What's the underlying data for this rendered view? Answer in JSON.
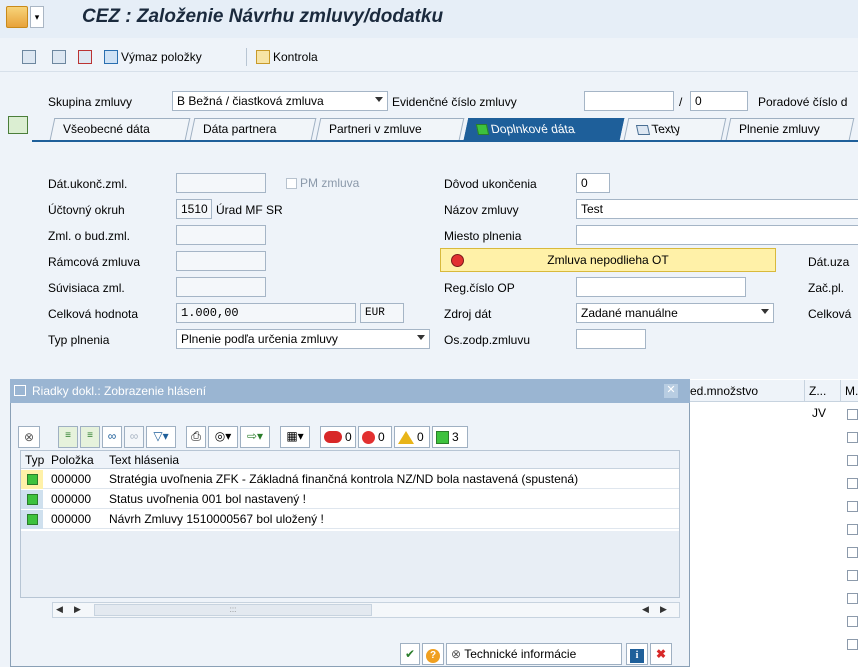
{
  "window": {
    "title": "CEZ : Založenie Návrhu zmluvy/dodatku"
  },
  "toolbar": {
    "delete_item": "Výmaz položky",
    "check": "Kontrola"
  },
  "header": {
    "group_label": "Skupina zmluvy",
    "group_value": "B Bežná / čiastková zmluva",
    "evidence_label": "Evidenčné číslo zmluvy",
    "evidence_slash": "/",
    "evidence_part2": "0",
    "order_label": "Poradové číslo d"
  },
  "tabs": [
    {
      "label": "Všeobecné dáta"
    },
    {
      "label": "Dáta partnera"
    },
    {
      "label": "Partneri v zmluve"
    },
    {
      "label": "Doplnkové dáta"
    },
    {
      "label": "Texty"
    },
    {
      "label": "Plnenie zmluvy"
    }
  ],
  "form": {
    "end_date_label": "Dát.ukonč.zml.",
    "pm_label": "PM zmluva",
    "reason_label": "Dôvod ukončenia",
    "reason_value": "0",
    "account_label": "Účtovný okruh",
    "account_code": "1510",
    "account_name": "Úrad MF SR",
    "contract_name_label": "Názov zmluvy",
    "contract_name_value": "Test",
    "future_label": "Zml. o bud.zml.",
    "place_label": "Miesto plnenia",
    "frame_label": "Rámcová zmluva",
    "ot_status": "Zmluva nepodlieha OT",
    "date_right": "Dát.uza",
    "related_label": "Súvisiaca zml.",
    "reg_label": "Reg.číslo OP",
    "start_right": "Zač.pl.",
    "total_label": "Celková hodnota",
    "total_value": "1.000,00",
    "currency": "EUR",
    "source_label": "Zdroj dát",
    "source_value": "Zadané manuálne",
    "total_right": "Celková",
    "type_label": "Typ plnenia",
    "type_value": "Plnenie podľa určenia zmluvy",
    "responsible_label": "Os.zodp.zmluvu"
  },
  "grid": {
    "col_qty": "ed.množstvo",
    "col_z": "Z...",
    "col_m": "M.",
    "first_z": "JV"
  },
  "dialog": {
    "title": "Riadky dokl.: Zobrazenie hlásení",
    "counts": {
      "stop": "0",
      "error": "0",
      "warning": "0",
      "success": "3"
    },
    "col_type": "Typ",
    "col_item": "Položka",
    "col_text": "Text hlásenia",
    "messages": [
      {
        "item": "000000",
        "text": "Stratégia uvoľnenia ZFK - Základná finančná kontrola NZ/ND bola nastavená (spustená)"
      },
      {
        "item": "000000",
        "text": "Status uvoľnenia 001 bol nastavený !"
      },
      {
        "item": "000000",
        "text": "Návrh Zmluvy 1510000567 bol uložený !"
      }
    ],
    "scroll_mid": ":::",
    "tech_info": "Technické informácie"
  },
  "colors": {
    "accent": "#1e5f9a",
    "success": "#3dc23d",
    "highlight": "#fff1a8"
  }
}
